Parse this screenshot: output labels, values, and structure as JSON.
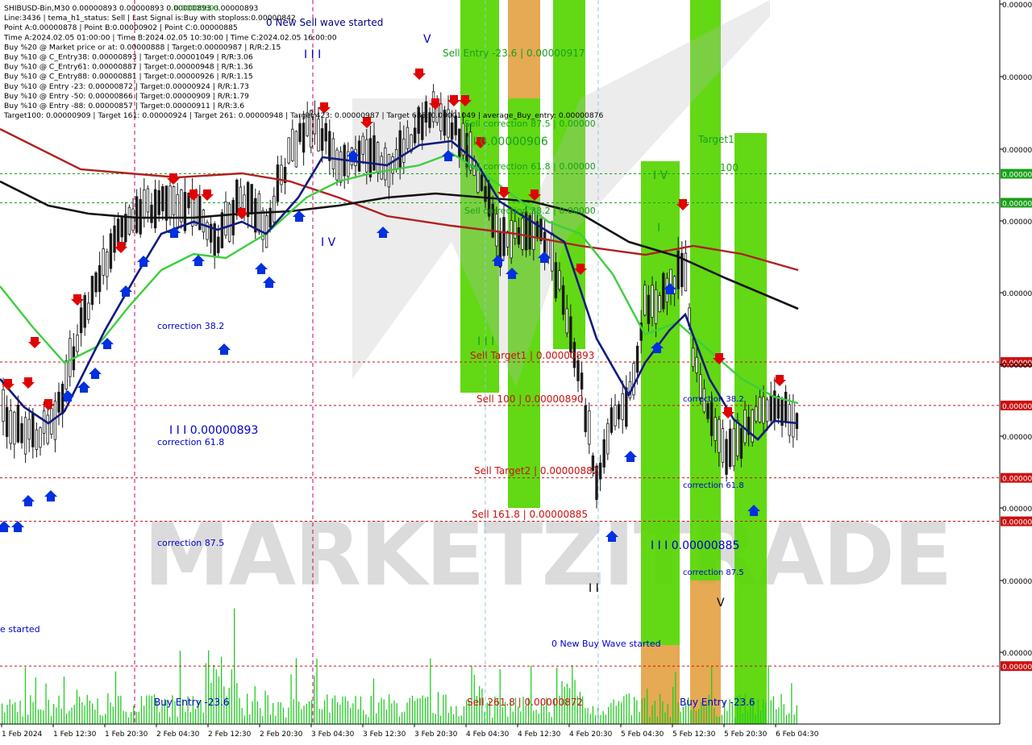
{
  "header": {
    "lines": [
      "SHIBUSD-Bin,M30  0.00000893 0.00000893 0.00000893 0.00000893",
      "Line:3436  |  tema_h1_status: Sell  |  Last Signal is:Buy with stoploss:0.00000842",
      "Point A:0.00000878  |  Point B:0.00000902  |  Point C:0.00000885",
      "Time A:2024.02.05 01:00:00  |  Time B:2024.02.05 10:30:00  |  Time C:2024.02.05 16:00:00",
      "Buy %20 @ Market price or at: 0.00000888  |  Target:0.00000987  |  R/R:2.15",
      "Buy %10 @ C_Entry38: 0.00000893  |  Target:0.00001049  |  R/R:3.06",
      "Buy %10 @ C_Entry61: 0.00000887  |  Target:0.00000948  |  R/R:1.36",
      "Buy %10 @ C_Entry88: 0.00000881  |  Target:0.00000926  |  R/R:1.15",
      "Buy %10 @ Entry -23: 0.00000872  |  Target:0.00000924  |  R/R:1.73",
      "Buy %10 @ Entry -50: 0.00000866  |  Target:0.00000909  |  R/R:1.79",
      "Buy %10 @ Entry -88: 0.00000857  |  Target:0.00000911  |  R/R:3.6",
      "Target100: 0.00000909  |  Target 161: 0.00000924  |  Target 261: 0.00000948  |  Target 423: 0.00000987  |  Target 685: 0.00001049  |  average_Buy_entry: 0.00000876"
    ],
    "overlay_value": "0.00000893"
  },
  "chart_data": {
    "type": "candlestick",
    "symbol": "SHIBUSD-Bin",
    "timeframe": "M30",
    "ylim": [
      8.68e-06,
      9.18e-06
    ],
    "xlabels": [
      "1 Feb 2024",
      "1 Feb 12:30",
      "1 Feb 20:30",
      "2 Feb 04:30",
      "2 Feb 12:30",
      "2 Feb 20:30",
      "3 Feb 04:30",
      "3 Feb 12:30",
      "3 Feb 20:30",
      "4 Feb 04:30",
      "4 Feb 12:30",
      "4 Feb 20:30",
      "5 Feb 04:30",
      "5 Feb 12:30",
      "5 Feb 20:30",
      "6 Feb 04:30"
    ],
    "yticks": [
      "0.00000",
      "0.00000",
      "0.00000",
      "0.00000",
      "0.00000",
      "0.00000",
      "0.00000",
      "0.00000",
      "0.00000",
      "0.00000"
    ],
    "price_tags": [
      {
        "label": "0.00000",
        "value": 9.06e-06
      },
      {
        "label": "0.00000",
        "value": 9.04e-06
      },
      {
        "label": "0.00000",
        "value": 8.93e-06
      },
      {
        "label": "0.00000",
        "value": 8.9e-06
      },
      {
        "label": "0.00000",
        "value": 8.85e-06
      },
      {
        "label": "0.00000",
        "value": 8.82e-06
      },
      {
        "label": "0.00000",
        "value": 8.72e-06
      }
    ],
    "levels": [
      {
        "label": "Sell Entry -23.6 | 0.00000917",
        "value": 9.17e-06
      },
      {
        "label": "Sell correction 87.5 | 0.00000",
        "value": 9.1e-06
      },
      {
        "label": "Sell correction 61.8 | 0.00000",
        "value": 9.06e-06
      },
      {
        "label": "Sell correction 38.2 | 0.00000",
        "value": 9.03e-06
      },
      {
        "label": "Sell Target1 | 0.00000893",
        "value": 8.93e-06
      },
      {
        "label": "Sell 100 | 0.00000890",
        "value": 8.9e-06
      },
      {
        "label": "Sell Target2 | 0.00000882",
        "value": 8.82e-06
      },
      {
        "label": "Sell 161.8 | 0.00000885",
        "value": 8.79e-06
      },
      {
        "label": "Sell  261.8 | 0.00000872",
        "value": 8.72e-06
      }
    ],
    "annotations": [
      "0 New Sell wave started",
      "0 New Buy Wave started",
      "Buy Entry -23.6",
      "Buy Entry -23.6",
      "correction 38.2",
      "correction 61.8",
      "correction 87.5",
      "correction 38.2",
      "correction 61.8",
      "correction 87.5",
      "I I I  0.00000893",
      "I I I  0.00000885",
      "I I  0.00000906",
      "Target1",
      "100",
      "I I I",
      "V",
      "I V",
      "I V",
      "I",
      "V",
      "I I",
      "I I I",
      "e started"
    ],
    "watermark": "MARKETZITRADE"
  }
}
